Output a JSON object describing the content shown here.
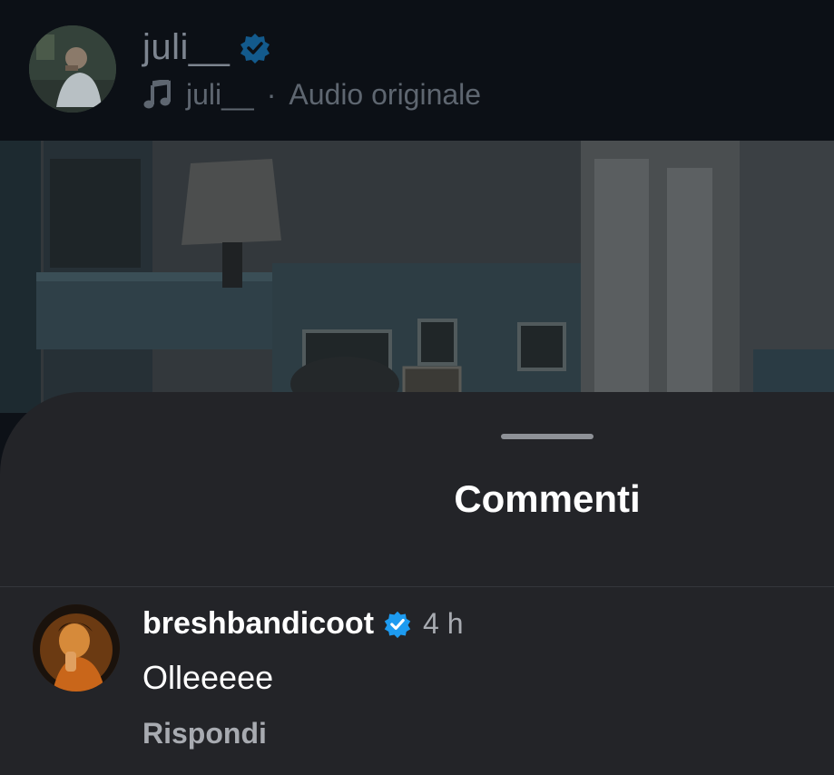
{
  "header": {
    "author_name": "juli__",
    "audio_author": "juli__",
    "audio_separator": "·",
    "audio_label": "Audio originale",
    "icons": [
      "verified-badge-icon",
      "music-note-icon"
    ]
  },
  "sheet": {
    "title": "Commenti"
  },
  "comments": [
    {
      "username": "breshbandicoot",
      "verified": true,
      "time": "4 h",
      "text": "Olleeeee",
      "reply_label": "Rispondi"
    }
  ],
  "colors": {
    "verified_blue": "#1d9bf0",
    "sheet_bg": "#232428",
    "header_bg": "#0c1016"
  }
}
